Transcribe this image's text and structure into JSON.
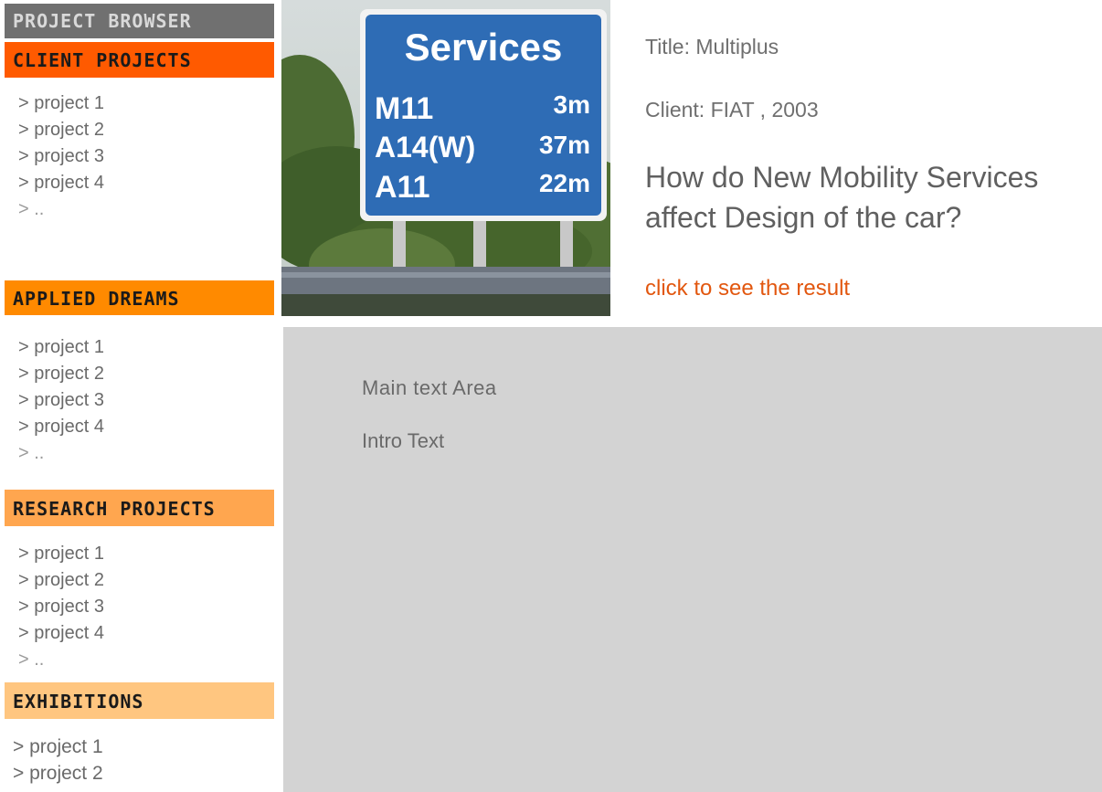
{
  "sidebar": {
    "browser_title": "PROJECT BROWSER",
    "sections": [
      {
        "title": "CLIENT PROJECTS",
        "items": [
          "> project 1",
          "> project 2",
          "> project 3",
          "> project 4",
          "> .."
        ],
        "color": "#ff5a00"
      },
      {
        "title": "APPLIED DREAMS",
        "items": [
          "> project 1",
          "> project 2",
          "> project 3",
          "> project 4",
          "> .."
        ],
        "color": "#ff8a00"
      },
      {
        "title": "RESEARCH PROJECTS",
        "items": [
          "> project 1",
          "> project 2",
          "> project 3",
          "> project 4",
          "> .."
        ],
        "color": "#ffa64f"
      },
      {
        "title": "EXHIBITIONS",
        "items": [
          "> project 1",
          "> project 2"
        ],
        "color": "#ffc680"
      }
    ]
  },
  "photo": {
    "sign": {
      "heading": "Services",
      "rows": [
        {
          "road": "M11",
          "dist": "3m"
        },
        {
          "road": "A14(W)",
          "dist": "37m"
        },
        {
          "road": "A11",
          "dist": "22m"
        }
      ]
    }
  },
  "project": {
    "title": "Title: Multiplus",
    "client": "Client: FIAT , 2003",
    "question": "How do New Mobility Services affect Design of the car?",
    "link": "click to see the result"
  },
  "content": {
    "main_label": "Main text Area",
    "intro": "Intro Text"
  },
  "colors": {
    "accent_link": "#e2570f",
    "content_bg": "#d3d3d3",
    "browser_header": "#707070"
  }
}
